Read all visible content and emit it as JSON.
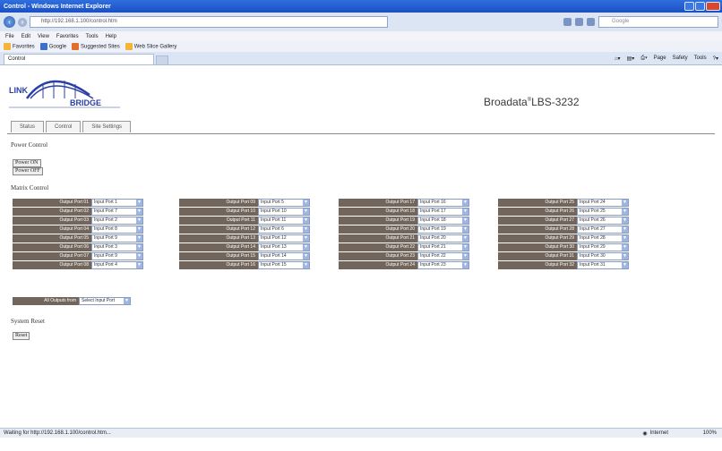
{
  "window": {
    "title": "Control - Windows Internet Explorer"
  },
  "address": {
    "url": "http://192.168.1.100/control.htm",
    "search_placeholder": "Google"
  },
  "menu": [
    "File",
    "Edit",
    "View",
    "Favorites",
    "Tools",
    "Help"
  ],
  "favorites": [
    "Favorites",
    "Google",
    "Suggested Sites",
    "Web Slice Gallery"
  ],
  "tab": {
    "label": "Control"
  },
  "command_bar": [
    "Page",
    "Safety",
    "Tools"
  ],
  "page": {
    "logo_text_top": "LINK",
    "logo_text_bottom": "BRIDGE",
    "product": "Broadata",
    "product_reg": "®",
    "product_model": "LBS-3232",
    "nav": [
      "Status",
      "Control",
      "Site Settings"
    ],
    "power_control_title": "Power Control",
    "power_on_label": "Power ON",
    "power_off_label": "Power OFF",
    "matrix_control_title": "Matrix Control",
    "system_reset_title": "System Reset",
    "reset_label": "Reset",
    "all_outputs_label": "All Outputs from",
    "all_outputs_value": "Select Input Port"
  },
  "routing": {
    "columns": [
      [
        {
          "label": "Output Port 01",
          "value": "Input Port 1"
        },
        {
          "label": "Output Port 02",
          "value": "Input Port 7"
        },
        {
          "label": "Output Port 03",
          "value": "Input Port 2"
        },
        {
          "label": "Output Port 04",
          "value": "Input Port 8"
        },
        {
          "label": "Output Port 05",
          "value": "Input Port 9"
        },
        {
          "label": "Output Port 06",
          "value": "Input Port 3"
        },
        {
          "label": "Output Port 07",
          "value": "Input Port 9"
        },
        {
          "label": "Output Port 08",
          "value": "Input Port 4"
        }
      ],
      [
        {
          "label": "Output Port 09",
          "value": "Input Port 5"
        },
        {
          "label": "Output Port 10",
          "value": "Input Port 10"
        },
        {
          "label": "Output Port 11",
          "value": "Input Port 11"
        },
        {
          "label": "Output Port 12",
          "value": "Input Port 6"
        },
        {
          "label": "Output Port 13",
          "value": "Input Port 12"
        },
        {
          "label": "Output Port 14",
          "value": "Input Port 13"
        },
        {
          "label": "Output Port 15",
          "value": "Input Port 14"
        },
        {
          "label": "Output Port 16",
          "value": "Input Port 15"
        }
      ],
      [
        {
          "label": "Output Port 17",
          "value": "Input Port 16"
        },
        {
          "label": "Output Port 18",
          "value": "Input Port 17"
        },
        {
          "label": "Output Port 19",
          "value": "Input Port 18"
        },
        {
          "label": "Output Port 20",
          "value": "Input Port 19"
        },
        {
          "label": "Output Port 21",
          "value": "Input Port 20"
        },
        {
          "label": "Output Port 22",
          "value": "Input Port 21"
        },
        {
          "label": "Output Port 23",
          "value": "Input Port 22"
        },
        {
          "label": "Output Port 24",
          "value": "Input Port 23"
        }
      ],
      [
        {
          "label": "Output Port 25",
          "value": "Input Port 24"
        },
        {
          "label": "Output Port 26",
          "value": "Input Port 25"
        },
        {
          "label": "Output Port 27",
          "value": "Input Port 26"
        },
        {
          "label": "Output Port 28",
          "value": "Input Port 27"
        },
        {
          "label": "Output Port 29",
          "value": "Input Port 28"
        },
        {
          "label": "Output Port 30",
          "value": "Input Port 29"
        },
        {
          "label": "Output Port 31",
          "value": "Input Port 30"
        },
        {
          "label": "Output Port 32",
          "value": "Input Port 31"
        }
      ]
    ]
  },
  "status": {
    "left": "Waiting for http://192.168.1.100/control.htm...",
    "zone": "Internet",
    "zoom": "100%"
  }
}
